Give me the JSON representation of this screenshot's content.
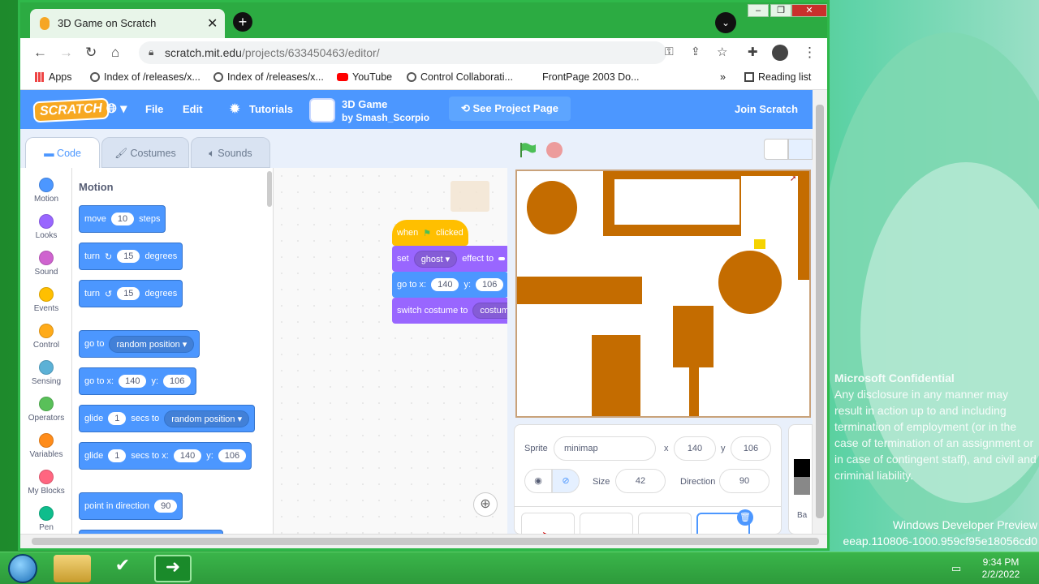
{
  "browser": {
    "tab_title": "3D Game on Scratch",
    "tab_close": "✕",
    "new_tab": "+",
    "tab_search": "⌄",
    "url_host": "scratch.mit.edu",
    "url_path": "/projects/633450463/editor/",
    "bookmarks": [
      {
        "label": "Apps"
      },
      {
        "label": "Index of /releases/x..."
      },
      {
        "label": "Index of /releases/x..."
      },
      {
        "label": "YouTube"
      },
      {
        "label": "Control Collaborati..."
      },
      {
        "label": "FrontPage 2003 Do..."
      }
    ],
    "more_bookmarks": "»",
    "reading_list": "Reading list"
  },
  "scratch": {
    "logo": "SCRATCH",
    "menu_file": "File",
    "menu_edit": "Edit",
    "menu_tutorials": "Tutorials",
    "project_title": "3D Game",
    "project_author": "by Smash_Scorpio",
    "see_project": "See Project Page",
    "join": "Join Scratch"
  },
  "editor": {
    "tab_code": "Code",
    "tab_costumes": "Costumes",
    "tab_sounds": "Sounds",
    "categories": [
      {
        "label": "Motion",
        "color": "#4c97ff"
      },
      {
        "label": "Looks",
        "color": "#9966ff"
      },
      {
        "label": "Sound",
        "color": "#cf63cf"
      },
      {
        "label": "Events",
        "color": "#ffbf00"
      },
      {
        "label": "Control",
        "color": "#ffab19"
      },
      {
        "label": "Sensing",
        "color": "#5cb1d6"
      },
      {
        "label": "Operators",
        "color": "#59c059"
      },
      {
        "label": "Variables",
        "color": "#ff8c1a"
      },
      {
        "label": "My Blocks",
        "color": "#ff6680"
      },
      {
        "label": "Pen",
        "color": "#0fbd8c"
      }
    ],
    "palette_title": "Motion",
    "blocks": {
      "move": "move",
      "move_val": "10",
      "steps": "steps",
      "turn": "turn",
      "turn_cw_val": "15",
      "turn_ccw_val": "15",
      "degrees": "degrees",
      "goto": "go to",
      "goto_target": "random position",
      "goto_xy": "go to x:",
      "x_val": "140",
      "y_lbl": "y:",
      "y_val": "106",
      "glide": "glide",
      "glide_secs": "1",
      "secs_to": "secs to",
      "glide_target": "random position",
      "secs_to_x": "secs to x:",
      "point": "point in direction",
      "point_val": "90"
    },
    "script": {
      "when": "when",
      "clicked": "clicked",
      "set": "set",
      "ghost": "ghost",
      "effect_to": "effect to",
      "goto_xy": "go to x:",
      "x": "140",
      "y_lbl": "y:",
      "y": "106",
      "switch_costume": "switch costume to",
      "costume": "costume"
    }
  },
  "sprite_info": {
    "sprite_label": "Sprite",
    "sprite_name": "minimap",
    "x_label": "x",
    "x": "140",
    "y_label": "y",
    "y": "106",
    "size_label": "Size",
    "size": "42",
    "direction_label": "Direction",
    "direction": "90",
    "stage_label": "Ba"
  },
  "desktop": {
    "watermark_title": "Microsoft Confidential",
    "watermark_body": "Any disclosure in any manner may result in action up to and including termination of employment (or in the case of termination of an assignment or in case of contingent staff), and civil and criminal liability.",
    "os_name": "Windows Developer Preview",
    "build": "eeap.110806-1000.959cf95e18056cd0",
    "time": "9:34 PM",
    "date": "2/2/2022"
  }
}
